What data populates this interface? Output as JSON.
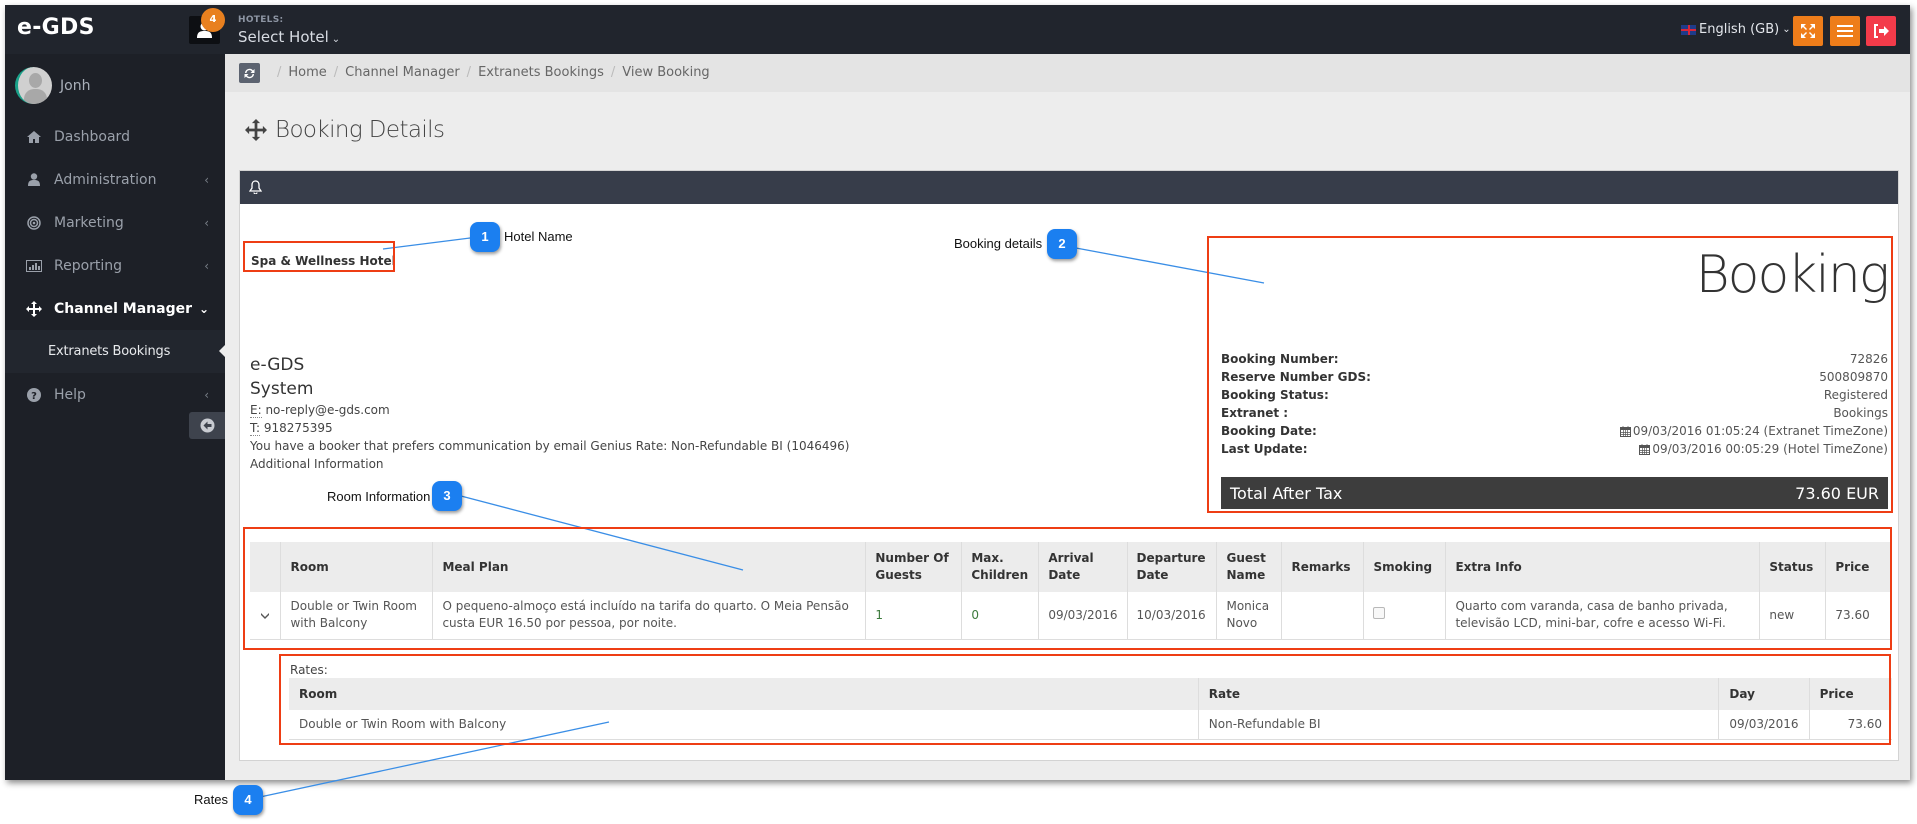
{
  "topbar": {
    "brand": "e-GDS",
    "notifications_count": "4",
    "hotels_label": "HOTELS:",
    "hotel_select": "Select Hotel",
    "language": "English (GB)",
    "icons": [
      "user-icon",
      "expand-icon",
      "menu-icon",
      "logout-icon"
    ],
    "colors": {
      "bar": "#21252d",
      "orange": "#ee7d1a",
      "red": "#f33b4a"
    }
  },
  "sidebar": {
    "user_name": "Jonh",
    "items": [
      {
        "label": "Dashboard",
        "icon": "home-icon",
        "has_arrow": false
      },
      {
        "label": "Administration",
        "icon": "user-icon",
        "has_arrow": true
      },
      {
        "label": "Marketing",
        "icon": "target-icon",
        "has_arrow": true
      },
      {
        "label": "Reporting",
        "icon": "bar-chart-icon",
        "has_arrow": true
      },
      {
        "label": "Channel Manager",
        "icon": "arrows-icon",
        "has_arrow": true,
        "expanded": true
      },
      {
        "label": "Help",
        "icon": "question-icon",
        "has_arrow": true
      }
    ],
    "sub_items": [
      {
        "label": "Extranets Bookings",
        "active": true
      }
    ]
  },
  "breadcrumb": [
    "Home",
    "Channel Manager",
    "Extranets Bookings",
    "View Booking"
  ],
  "page_title": "Booking Details",
  "hotel": {
    "name": "Spa & Wellness Hotel"
  },
  "system": {
    "line1": "e-GDS",
    "line2": "System",
    "email_prefix": "E:",
    "email": "no-reply@e-gds.com",
    "phone_prefix": "T:",
    "phone": "918275395",
    "note": "You have a booker that prefers communication by email Genius Rate: Non-Refundable BI (1046496)",
    "additional": "Additional Information"
  },
  "booking": {
    "title": "Booking",
    "fields": [
      {
        "label": "Booking Number:",
        "value": "72826",
        "icon": false
      },
      {
        "label": "Reserve Number GDS:",
        "value": "500809870",
        "icon": false
      },
      {
        "label": "Booking Status:",
        "value": "Registered",
        "icon": false
      },
      {
        "label": "Extranet :",
        "value": "Bookings",
        "icon": false
      },
      {
        "label": "Booking Date:",
        "value": "09/03/2016 01:05:24 (Extranet TimeZone)",
        "icon": true
      },
      {
        "label": "Last Update:",
        "value": "09/03/2016 00:05:29 (Hotel TimeZone)",
        "icon": true
      }
    ],
    "total_label": "Total After Tax",
    "total_value": "73.60 EUR"
  },
  "rooms": {
    "headers": [
      "",
      "Room",
      "Meal Plan",
      "Number Of Guests",
      "Max. Children",
      "Arrival Date",
      "Departure Date",
      "Guest Name",
      "Remarks",
      "Smoking",
      "Extra Info",
      "Status",
      "Price"
    ],
    "rows": [
      {
        "room": "Double or Twin Room with Balcony",
        "meal_plan": "O pequeno-almoço está incluído na tarifa do quarto. O Meia Pensão custa EUR 16.50 por pessoa, por noite.",
        "guests": "1",
        "max_children": "0",
        "arrival": "09/03/2016",
        "departure": "10/03/2016",
        "guest_name": "Monica Novo",
        "remarks": "",
        "smoking": false,
        "extra_info": "Quarto com varanda, casa de banho privada, televisão LCD, mini-bar, cofre e acesso Wi-Fi.",
        "status": "new",
        "price": "73.60"
      }
    ]
  },
  "rates": {
    "label": "Rates:",
    "headers": [
      "Room",
      "Rate",
      "Day",
      "Price"
    ],
    "rows": [
      {
        "room": "Double or Twin Room with Balcony",
        "rate": "Non-Refundable BI",
        "day": "09/03/2016",
        "price": "73.60"
      }
    ]
  },
  "annotations": [
    {
      "number": "1",
      "label": "Hotel Name"
    },
    {
      "number": "2",
      "label": "Booking details"
    },
    {
      "number": "3",
      "label": "Room Information"
    },
    {
      "number": "4",
      "label": "Rates"
    }
  ],
  "annotation_colors": {
    "box": "#ee3d14",
    "badge": "#1b7ff0"
  }
}
